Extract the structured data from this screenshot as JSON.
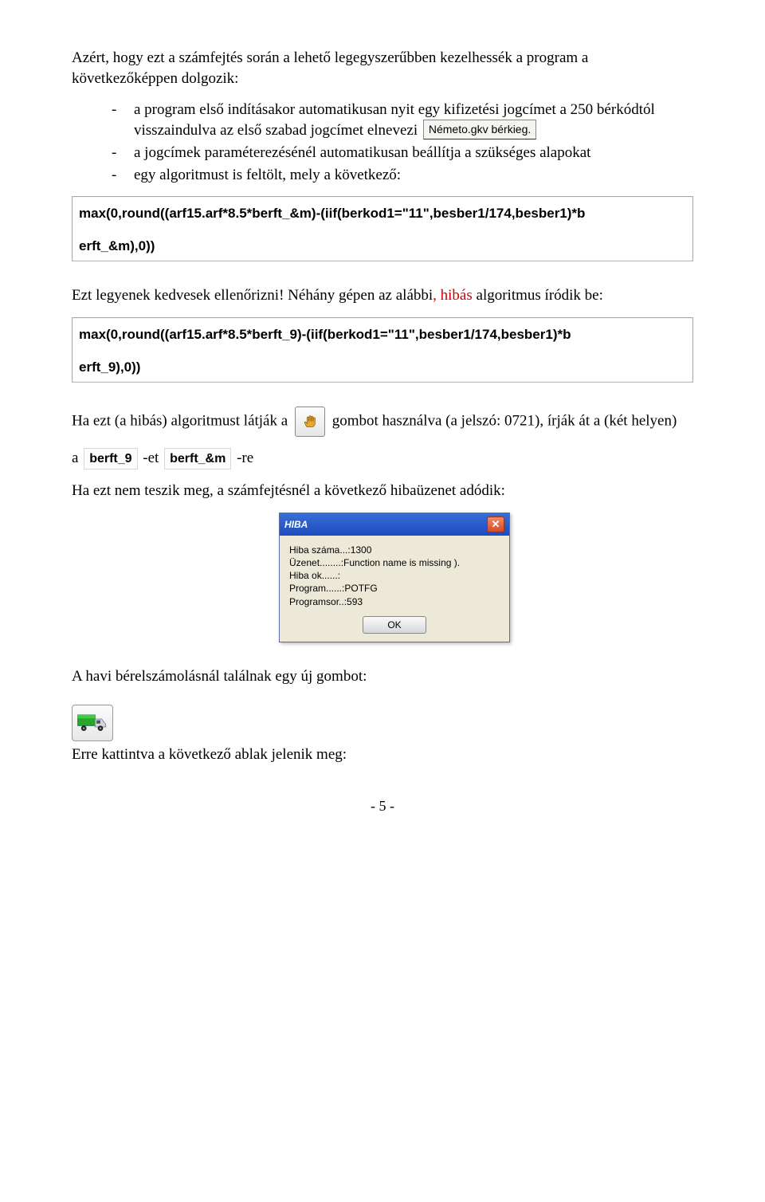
{
  "para1": "Azért, hogy ezt a számfejtés során a lehető legegyszerűbben kezelhessék a program a következőképpen dolgozik:",
  "bullets": {
    "b1_prefix": "a program első indításakor automatikusan nyit egy kifizetési jogcímet a 250 bérkódtól visszaindulva az első szabad jogcímet elnevezi ",
    "field1": "Németo.gkv bérkieg.",
    "b2": "a jogcímek paraméterezésénél automatikusan beállítja a szükséges alapokat",
    "b3": "egy algoritmust is feltölt, mely a következő:"
  },
  "formula1": {
    "line_a": "max(0,round((arf15.arf*8.5*berft_&m)-(iif(berkod1=\"11\",besber1/174,besber1)*b",
    "line_b": "erft_&m),0))"
  },
  "para2_a": "Ezt legyenek kedvesek ellenőrizni! Néhány gépen az alábbi",
  "para2_red": ", hibás ",
  "para2_b": "algoritmus íródik be:",
  "formula2": {
    "line_a": "max(0,round((arf15.arf*8.5*berft_9)-(iif(berkod1=\"11\",besber1/174,besber1)*b",
    "line_b": "erft_9),0))"
  },
  "para3_a": "Ha ezt (a hibás) algoritmust látják a ",
  "para3_b": " gombot használva (a jelszó: 0721), írják át a (két helyen)",
  "para4_a": "a ",
  "embed1": "berft_9",
  "para4_b": " -et  ",
  "embed2": "berft_&m",
  "para4_c": "  -re",
  "para5": "Ha ezt nem teszik meg, a számfejtésnél a következő hibaüzenet adódik:",
  "dialog": {
    "title": "HIBA",
    "lines": [
      "Hiba száma...:1300",
      "Üzenet........:Function name is missing ).",
      "Hiba ok......:",
      "Program......:POTFG",
      "Programsor..:593"
    ],
    "ok": "OK"
  },
  "para6": "A havi bérelszámolásnál találnak egy új gombot:",
  "para7": "Erre kattintva a következő ablak jelenik meg:",
  "footer": "- 5 -"
}
